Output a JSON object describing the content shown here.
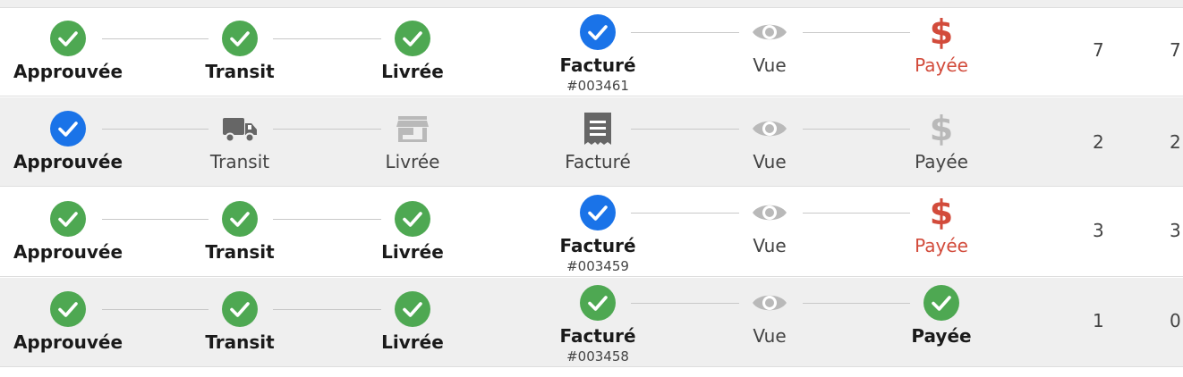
{
  "colors": {
    "done_green": "#4ea852",
    "current_blue": "#1a73e8",
    "paid_red": "#d24b3b",
    "inactive_gray": "#b9b9b9",
    "icon_dark": "#666666"
  },
  "orders": [
    {
      "steps": [
        {
          "label": "Approuvée",
          "status": "done",
          "icon": "check-icon"
        },
        {
          "label": "Transit",
          "status": "done",
          "icon": "check-icon"
        },
        {
          "label": "Livrée",
          "status": "done",
          "icon": "check-icon"
        },
        {
          "label": "Facturé",
          "status": "current",
          "icon": "check-icon",
          "sub": "#003461"
        },
        {
          "label": "Vue",
          "status": "inactive",
          "icon": "eye-icon"
        },
        {
          "label": "Payée",
          "status": "due",
          "icon": "dollar-icon"
        }
      ],
      "qty_a": "7",
      "qty_b": "7"
    },
    {
      "steps": [
        {
          "label": "Approuvée",
          "status": "current",
          "icon": "check-icon"
        },
        {
          "label": "Transit",
          "status": "pending",
          "icon": "truck-icon"
        },
        {
          "label": "Livrée",
          "status": "inactive",
          "icon": "store-icon"
        },
        {
          "label": "Facturé",
          "status": "pending",
          "icon": "receipt-icon"
        },
        {
          "label": "Vue",
          "status": "inactive",
          "icon": "eye-icon"
        },
        {
          "label": "Payée",
          "status": "inactive",
          "icon": "dollar-icon"
        }
      ],
      "qty_a": "2",
      "qty_b": "2"
    },
    {
      "steps": [
        {
          "label": "Approuvée",
          "status": "done",
          "icon": "check-icon"
        },
        {
          "label": "Transit",
          "status": "done",
          "icon": "check-icon"
        },
        {
          "label": "Livrée",
          "status": "done",
          "icon": "check-icon"
        },
        {
          "label": "Facturé",
          "status": "current",
          "icon": "check-icon",
          "sub": "#003459"
        },
        {
          "label": "Vue",
          "status": "inactive",
          "icon": "eye-icon"
        },
        {
          "label": "Payée",
          "status": "due",
          "icon": "dollar-icon"
        }
      ],
      "qty_a": "3",
      "qty_b": "3"
    },
    {
      "steps": [
        {
          "label": "Approuvée",
          "status": "done",
          "icon": "check-icon"
        },
        {
          "label": "Transit",
          "status": "done",
          "icon": "check-icon"
        },
        {
          "label": "Livrée",
          "status": "done",
          "icon": "check-icon"
        },
        {
          "label": "Facturé",
          "status": "done",
          "icon": "check-icon",
          "sub": "#003458"
        },
        {
          "label": "Vue",
          "status": "inactive",
          "icon": "eye-icon"
        },
        {
          "label": "Payée",
          "status": "done",
          "icon": "check-icon"
        }
      ],
      "qty_a": "1",
      "qty_b": "0"
    }
  ]
}
